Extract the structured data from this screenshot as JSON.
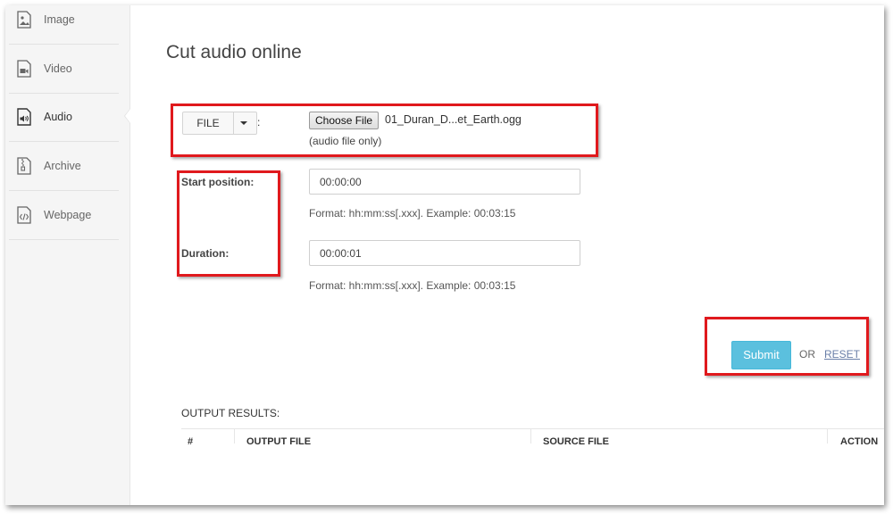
{
  "sidebar": {
    "items": [
      {
        "label": "Image",
        "icon": "image-file-icon"
      },
      {
        "label": "Video",
        "icon": "video-file-icon"
      },
      {
        "label": "Audio",
        "icon": "audio-file-icon"
      },
      {
        "label": "Archive",
        "icon": "archive-file-icon"
      },
      {
        "label": "Webpage",
        "icon": "webpage-file-icon"
      }
    ],
    "active": "Audio"
  },
  "main": {
    "title": "Cut audio online",
    "file_source": {
      "label": "FILE",
      "colon": ":"
    },
    "file_input": {
      "button_label": "Choose File",
      "file_name": "01_Duran_D...et_Earth.ogg",
      "hint": "(audio file only)"
    },
    "start_position": {
      "label": "Start position:",
      "value": "00:00:00",
      "help": "Format: hh:mm:ss[.xxx]. Example: 00:03:15"
    },
    "duration": {
      "label": "Duration:",
      "value": "00:00:01",
      "help": "Format: hh:mm:ss[.xxx]. Example: 00:03:15"
    },
    "actions": {
      "submit_label": "Submit",
      "or_label": "OR",
      "reset_label": "RESET"
    },
    "output": {
      "title": "OUTPUT RESULTS:",
      "columns": [
        "#",
        "OUTPUT FILE",
        "SOURCE FILE",
        "ACTION"
      ]
    }
  },
  "colors": {
    "accent": "#5bc0de",
    "highlight_box": "#e0191d",
    "link": "#6a7fa8"
  }
}
